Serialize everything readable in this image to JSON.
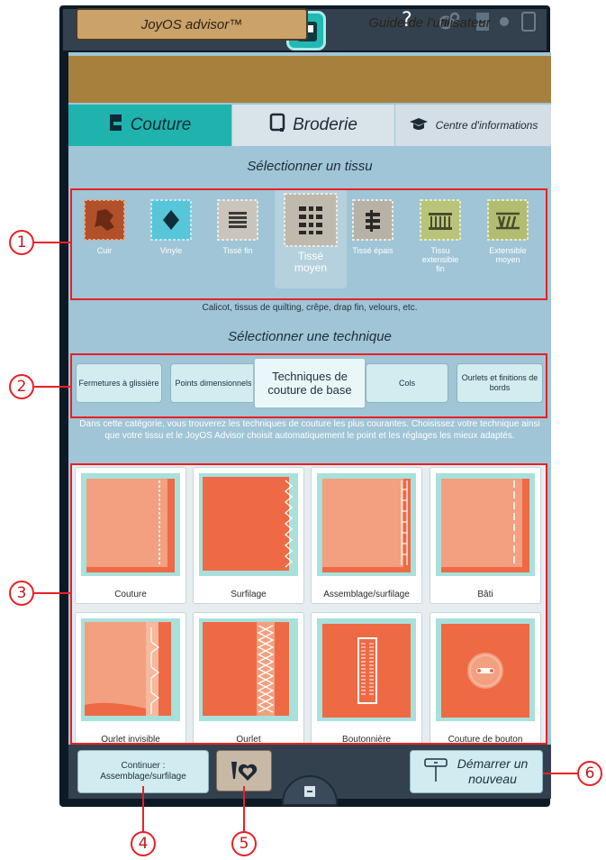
{
  "statusbar": {
    "icons": [
      "wifi-alert-icon",
      "cloud-icon",
      "upload-icon",
      "home-icon",
      "help-icon",
      "settings-icon",
      "embroidery-mode-icon",
      "toggle-icon",
      "tablet-icon"
    ],
    "help_label": "?"
  },
  "topnav": {
    "advisor_label": "JoyOS advisor™",
    "guide_label": "Guide de l'utilisateur"
  },
  "tabs": [
    {
      "label": "Couture",
      "icon": "sewing-machine-icon",
      "active": true
    },
    {
      "label": "Broderie",
      "icon": "embroidery-hoop-icon",
      "active": false
    },
    {
      "label": "Centre d'informations",
      "icon": "graduation-cap-icon",
      "active": false
    }
  ],
  "fabric_section": {
    "title": "Sélectionner un tissu",
    "items": [
      {
        "label": "Cuir",
        "color": "#b2502a",
        "selected": false
      },
      {
        "label": "Vinyle",
        "color": "#56c6d8",
        "selected": false
      },
      {
        "label": "Tissé fin",
        "color": "#c9c5bc",
        "selected": false
      },
      {
        "label": "Tissé moyen",
        "color": "#bfb9ae",
        "selected": true
      },
      {
        "label": "Tissé épais",
        "color": "#b7b1a6",
        "selected": false
      },
      {
        "label": "Tissu extensible fin",
        "color": "#b9c47a",
        "selected": false
      },
      {
        "label": "Extensible moyen",
        "color": "#b3bd72",
        "selected": false
      }
    ],
    "description": "Calicot, tissus de quilting, crêpe, drap fin, velours, etc."
  },
  "technique_section": {
    "title": "Sélectionner une technique",
    "items": [
      {
        "label": "Fermetures à glissière",
        "selected": false
      },
      {
        "label": "Points dimensionnels",
        "selected": false
      },
      {
        "label": "Techniques de couture de base",
        "selected": true
      },
      {
        "label": "Cols",
        "selected": false
      },
      {
        "label": "Ourlets et finitions de bords",
        "selected": false
      }
    ],
    "description": "Dans cette catégorie, vous trouverez les techniques de couture les plus courantes. Choisissez votre technique ainsi que votre tissu et le JoyOS Advisor choisit automatiquement le point et les réglages les mieux adaptés."
  },
  "stitches": [
    {
      "label": "Couture"
    },
    {
      "label": "Surfilage"
    },
    {
      "label": "Assemblage/surfilage"
    },
    {
      "label": "Bâti"
    },
    {
      "label": "Ourlet invisible"
    },
    {
      "label": "Ourlet"
    },
    {
      "label": "Boutonnière"
    },
    {
      "label": "Couture de bouton"
    }
  ],
  "bottombar": {
    "continue_label": "Continuer : Assemblage/surfilage",
    "start_label": "Démarrer un nouveau"
  },
  "callouts": [
    "1",
    "2",
    "3",
    "4",
    "5",
    "6"
  ],
  "colors": {
    "accent": "#20b3ae",
    "highlight": "#ea2024",
    "fabric_orange": "#ee6a45",
    "fabric_peach": "#f2a07f"
  }
}
